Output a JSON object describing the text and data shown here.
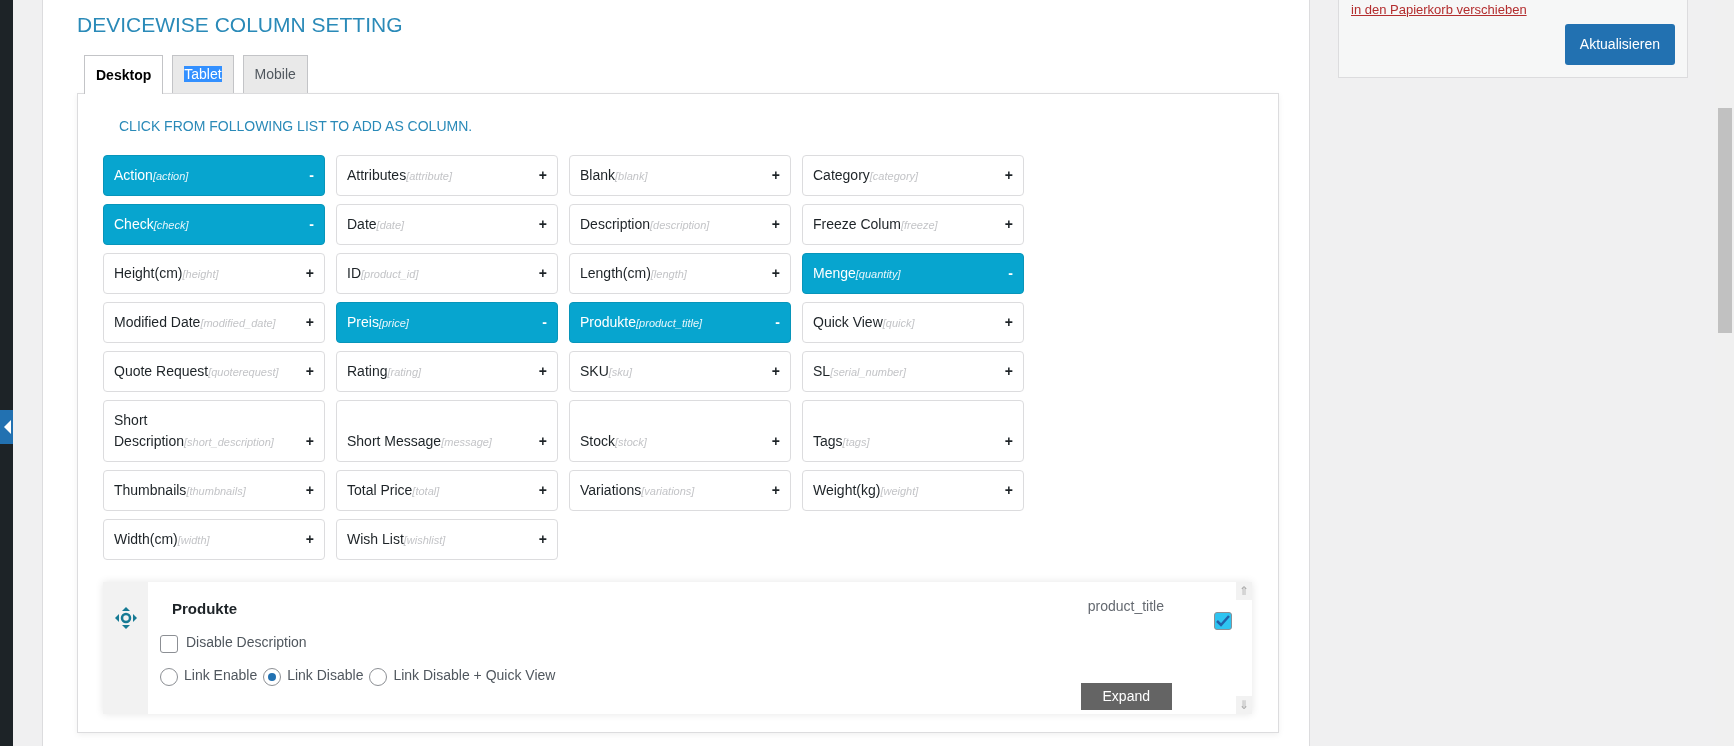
{
  "title": "DEVICEWISE COLUMN SETTING",
  "tabs": [
    {
      "label": "Desktop",
      "selected": true,
      "text_highlighted": false
    },
    {
      "label": "Tablet",
      "selected": false,
      "text_highlighted": true
    },
    {
      "label": "Mobile",
      "selected": false,
      "text_highlighted": false
    }
  ],
  "instruction": "CLICK FROM FOLLOWING LIST TO ADD AS COLUMN.",
  "columns": [
    {
      "label": "Action",
      "key": "[action]",
      "sign": "-",
      "selected": true
    },
    {
      "label": "Attributes",
      "key": "[attribute]",
      "sign": "+",
      "selected": false
    },
    {
      "label": "Blank",
      "key": "[blank]",
      "sign": "+",
      "selected": false
    },
    {
      "label": "Category",
      "key": "[category]",
      "sign": "+",
      "selected": false
    },
    {
      "label": "Check",
      "key": "[check]",
      "sign": "-",
      "selected": true
    },
    {
      "label": "Date",
      "key": "[date]",
      "sign": "+",
      "selected": false
    },
    {
      "label": "Description",
      "key": "[description]",
      "sign": "+",
      "selected": false
    },
    {
      "label": "Freeze Colum",
      "key": "[freeze]",
      "sign": "+",
      "selected": false
    },
    {
      "label": "Height(cm)",
      "key": "[height]",
      "sign": "+",
      "selected": false
    },
    {
      "label": "ID",
      "key": "[product_id]",
      "sign": "+",
      "selected": false
    },
    {
      "label": "Length(cm)",
      "key": "[length]",
      "sign": "+",
      "selected": false
    },
    {
      "label": "Menge",
      "key": "[quantity]",
      "sign": "-",
      "selected": true
    },
    {
      "label": "Modified Date",
      "key": "[modified_date]",
      "sign": "+",
      "selected": false
    },
    {
      "label": "Preis",
      "key": "[price]",
      "sign": "-",
      "selected": true
    },
    {
      "label": "Produkte",
      "key": "[product_title]",
      "sign": "-",
      "selected": true
    },
    {
      "label": "Quick View",
      "key": "[quick]",
      "sign": "+",
      "selected": false
    },
    {
      "label": "Quote Request",
      "key": "[quoterequest]",
      "sign": "+",
      "selected": false
    },
    {
      "label": "Rating",
      "key": "[rating]",
      "sign": "+",
      "selected": false
    },
    {
      "label": "SKU",
      "key": "[sku]",
      "sign": "+",
      "selected": false
    },
    {
      "label": "SL",
      "key": "[serial_number]",
      "sign": "+",
      "selected": false
    },
    {
      "label": "Short Description",
      "key": "[short_description]",
      "sign": "+",
      "selected": false
    },
    {
      "label": "Short Message",
      "key": "[message]",
      "sign": "+",
      "selected": false
    },
    {
      "label": "Stock",
      "key": "[stock]",
      "sign": "+",
      "selected": false
    },
    {
      "label": "Tags",
      "key": "[tags]",
      "sign": "+",
      "selected": false
    },
    {
      "label": "Thumbnails",
      "key": "[thumbnails]",
      "sign": "+",
      "selected": false
    },
    {
      "label": "Total Price",
      "key": "[total]",
      "sign": "+",
      "selected": false
    },
    {
      "label": "Variations",
      "key": "[variations]",
      "sign": "+",
      "selected": false
    },
    {
      "label": "Weight(kg)",
      "key": "[weight]",
      "sign": "+",
      "selected": false
    },
    {
      "label": "Width(cm)",
      "key": "[width]",
      "sign": "+",
      "selected": false
    },
    {
      "label": "Wish List",
      "key": "[wishlist]",
      "sign": "+",
      "selected": false
    }
  ],
  "column_card": {
    "title": "Produkte",
    "key_label": "product_title",
    "enabled": {
      "checked": true
    },
    "disable_description": {
      "label": "Disable Description",
      "checked": false
    },
    "link_options": [
      {
        "label": "Link Enable",
        "selected": false
      },
      {
        "label": "Link Disable",
        "selected": true
      },
      {
        "label": "Link Disable + Quick View",
        "selected": false
      }
    ],
    "up_arrow": "⇑",
    "down_arrow": "⇓",
    "expand_button": "Expand"
  },
  "sidebar": {
    "trash_link": "in den Papierkorb verschieben",
    "update_button": "Aktualisieren"
  }
}
